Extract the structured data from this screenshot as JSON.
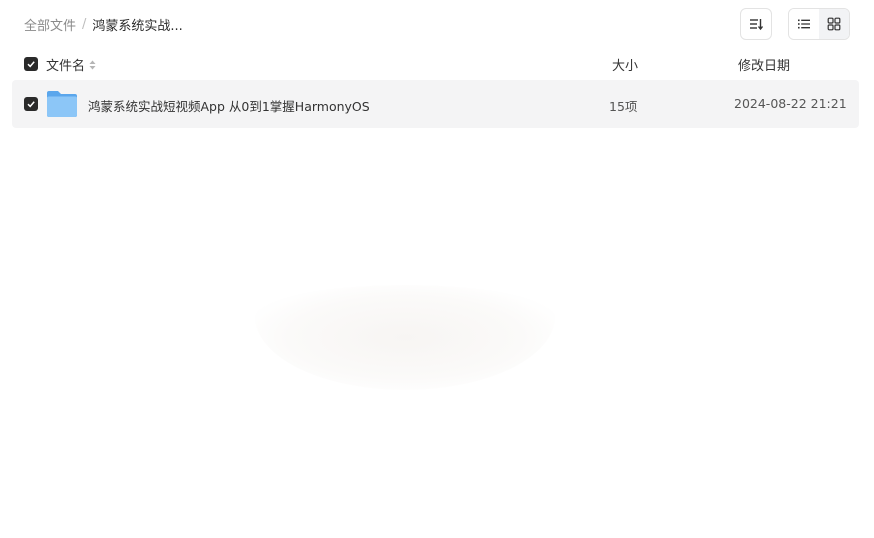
{
  "breadcrumb": {
    "root": "全部文件",
    "separator": "/",
    "current": "鸿蒙系统实战..."
  },
  "toolbar": {
    "sort_icon": "sort-icon",
    "list_view_icon": "list-view-icon",
    "grid_view_icon": "grid-view-icon"
  },
  "table": {
    "columns": {
      "name": "文件名",
      "size": "大小",
      "modified": "修改日期"
    },
    "rows": [
      {
        "icon": "folder-icon",
        "name": "鸿蒙系统实战短视频App 从0到1掌握HarmonyOS",
        "size": "15项",
        "modified": "2024-08-22 21:21",
        "checked": true
      }
    ]
  },
  "colors": {
    "accent_dark": "#2a2a2a",
    "row_background": "#f4f4f5",
    "folder_blue": "#6cb4f2"
  }
}
